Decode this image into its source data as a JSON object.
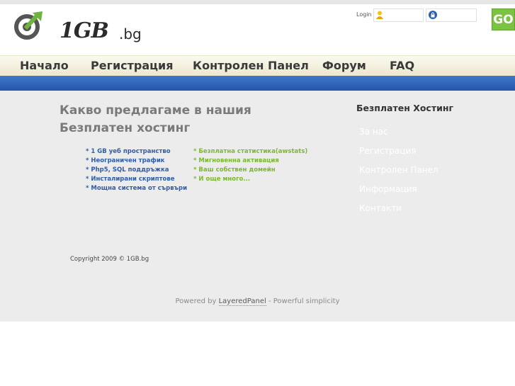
{
  "header": {
    "logo_text": "1GB",
    "logo_tld": ".bg",
    "login_label": "Login",
    "go_label": "GO"
  },
  "nav": {
    "items": [
      "Начало",
      "Регистрация",
      "Контролен Панел",
      "Форум",
      "FAQ"
    ]
  },
  "main": {
    "headline_line1": "Какво предлагаме в нашия",
    "headline_line2": "Безплатен хостинг",
    "features_left": [
      "* 1 GB уеб пространство",
      "* Неограничен трафик",
      "* Php5, SQL поддръжка",
      "* Инсталирани скриптове",
      "* Мощна система от сървъри"
    ],
    "features_right": [
      "* Безплатна статистика(awstats)",
      "* Мигновенна активация",
      "* Ваш собствен домейн",
      "* И още много..."
    ],
    "copyright": "Copyright 2009 © 1GB.bg"
  },
  "sidebar": {
    "title": "Безплатен Хостинг",
    "links": [
      "За нас",
      "Регистрация",
      "Контролен Панел",
      "Информация",
      "Контакти"
    ]
  },
  "footer": {
    "prefix": "Powered by",
    "link": "LayeredPanel",
    "suffix": "- Powerful simplicity"
  },
  "colors": {
    "accent_blue": "#2456ad",
    "go_green": "#7cc243",
    "feature_blue": "#2f5da8",
    "feature_green": "#7cb82e"
  }
}
